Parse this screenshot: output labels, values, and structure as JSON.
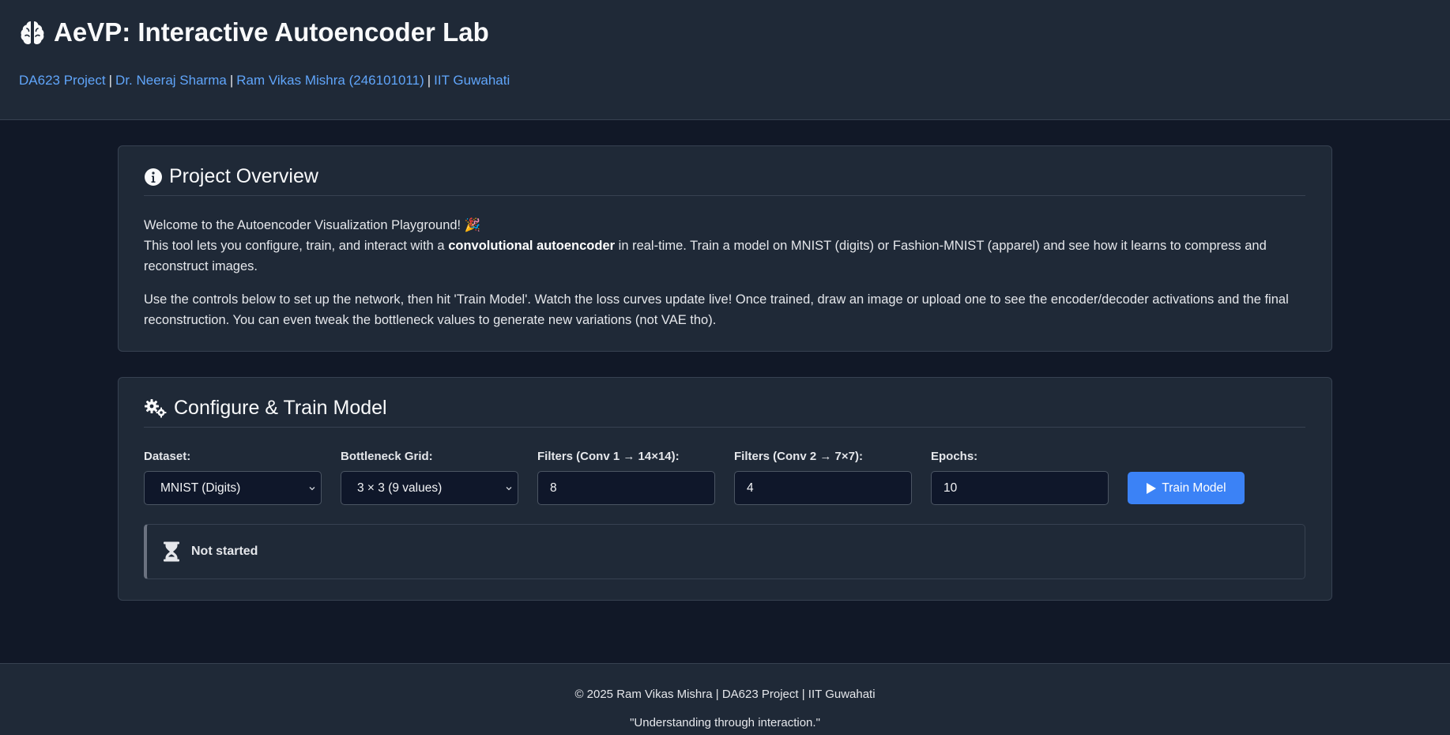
{
  "header": {
    "title": "AeVP: Interactive Autoencoder Lab",
    "links": [
      "DA623 Project",
      "Dr. Neeraj Sharma",
      "Ram Vikas Mishra (246101011)",
      "IIT Guwahati"
    ],
    "separator": "|"
  },
  "overview": {
    "title": "Project Overview",
    "welcome": "Welcome to the Autoencoder Visualization Playground! 🎉",
    "p1_before": "This tool lets you configure, train, and interact with a ",
    "p1_bold": "convolutional autoencoder",
    "p1_after": " in real-time. Train a model on MNIST (digits) or Fashion-MNIST (apparel) and see how it learns to compress and reconstruct images.",
    "p2": "Use the controls below to set up the network, then hit 'Train Model'. Watch the loss curves update live! Once trained, draw an image or upload one to see the encoder/decoder activations and the final reconstruction. You can even tweak the bottleneck values to generate new variations (not VAE tho)."
  },
  "config": {
    "title": "Configure & Train Model",
    "dataset_label": "Dataset:",
    "dataset_value": "MNIST (Digits)",
    "bottleneck_label": "Bottleneck Grid:",
    "bottleneck_value": "3 × 3 (9 values)",
    "filters1_label": "Filters (Conv 1 → 14×14):",
    "filters1_value": "8",
    "filters2_label": "Filters (Conv 2 → 7×7):",
    "filters2_value": "4",
    "epochs_label": "Epochs:",
    "epochs_value": "10",
    "train_button": "Train Model",
    "accent_color": "#3b82f6"
  },
  "status": {
    "text": "Not started",
    "icon": "hourglass-icon"
  },
  "footer": {
    "copyright": "© 2025 Ram Vikas Mishra | DA623 Project | IIT Guwahati",
    "tagline": "\"Understanding through interaction.\""
  }
}
